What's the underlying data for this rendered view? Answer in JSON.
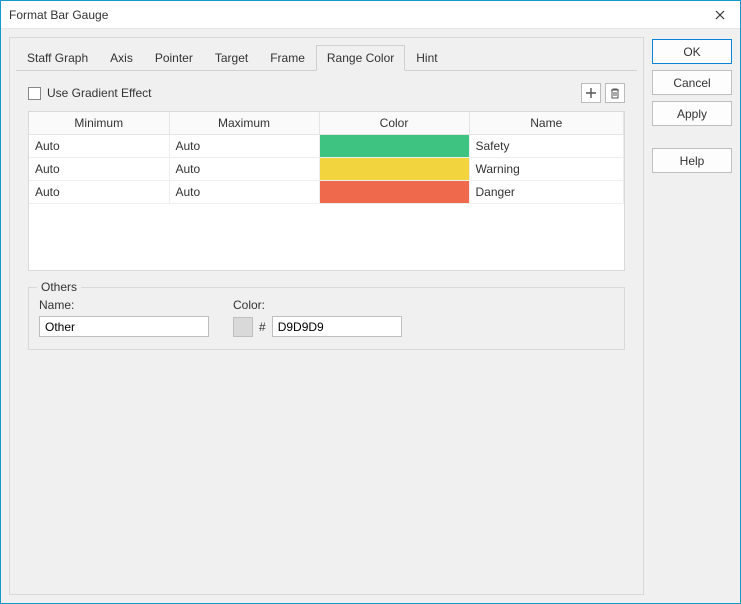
{
  "window": {
    "title": "Format Bar Gauge"
  },
  "tabs": {
    "items": [
      {
        "label": "Staff Graph"
      },
      {
        "label": "Axis"
      },
      {
        "label": "Pointer"
      },
      {
        "label": "Target"
      },
      {
        "label": "Frame"
      },
      {
        "label": "Range Color"
      },
      {
        "label": "Hint"
      }
    ],
    "active_index": 5
  },
  "options": {
    "use_gradient_label": "Use Gradient Effect",
    "use_gradient_checked": false
  },
  "table": {
    "headers": {
      "min": "Minimum",
      "max": "Maximum",
      "color": "Color",
      "name": "Name"
    },
    "rows": [
      {
        "min": "Auto",
        "max": "Auto",
        "color": "#3fc380",
        "name": "Safety"
      },
      {
        "min": "Auto",
        "max": "Auto",
        "color": "#f2d43f",
        "name": "Warning"
      },
      {
        "min": "Auto",
        "max": "Auto",
        "color": "#ef6a4c",
        "name": "Danger"
      }
    ]
  },
  "others": {
    "legend": "Others",
    "name_label": "Name:",
    "name_value": "Other",
    "color_label": "Color:",
    "hash": "#",
    "color_hex": "D9D9D9",
    "swatch": "#d9d9d9"
  },
  "buttons": {
    "ok": "OK",
    "cancel": "Cancel",
    "apply": "Apply",
    "help": "Help"
  }
}
